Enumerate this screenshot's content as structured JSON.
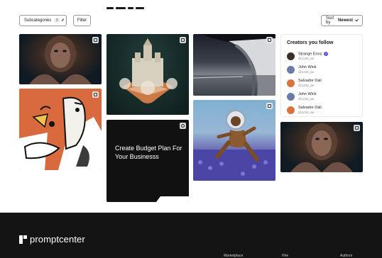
{
  "toolbar": {
    "subcategories_label": "Subcategories",
    "subcategories_count": "0",
    "filter_label": "Filter",
    "sort_prefix": "Sort by",
    "sort_value": "Newest"
  },
  "promo": {
    "title": "Create Budget Plan For Your Businesss"
  },
  "creators": {
    "heading": "Creators you follow",
    "items": [
      {
        "name": "Strange Eons",
        "handle": "@1234_ae",
        "verified": true,
        "avatar_color": "#3a2e2a"
      },
      {
        "name": "John Wick",
        "handle": "@1234_ae",
        "verified": false,
        "avatar_color": "#6b7aa6"
      },
      {
        "name": "Salvador Dali",
        "handle": "@1234_ae",
        "verified": false,
        "avatar_color": "#d9743c"
      },
      {
        "name": "John Wick",
        "handle": "@1234_ae",
        "verified": false,
        "avatar_color": "#6b7aa6"
      },
      {
        "name": "Salvador Dali",
        "handle": "@1234_ae",
        "verified": false,
        "avatar_color": "#d9743c"
      }
    ]
  },
  "footer": {
    "brand": "promptcenter",
    "links": [
      "Marketplace",
      "Hire",
      "Authors"
    ]
  },
  "colors": {
    "accent": "#5b54e8",
    "footer_bg": "#141414"
  }
}
